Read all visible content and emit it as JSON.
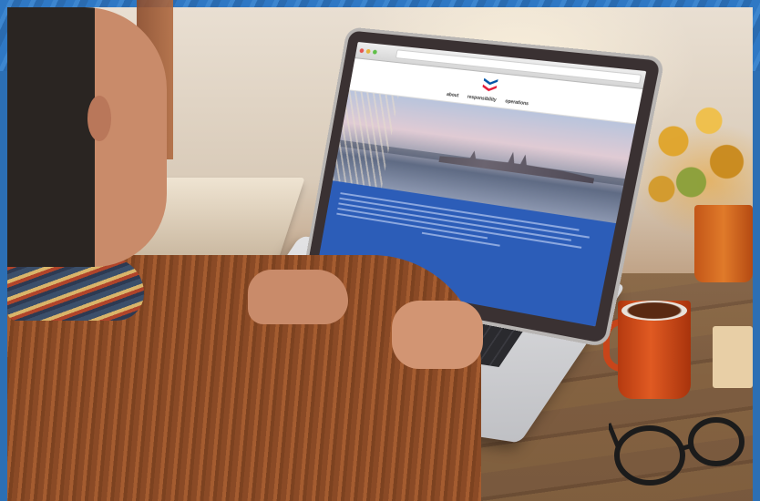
{
  "scene": {
    "description_alt": "",
    "accent_colors": {
      "blue_band": "#2c5db8",
      "sweater": "#a45c30",
      "mug": "#e05a22",
      "logo_blue": "#0054a6",
      "logo_red": "#e31937"
    }
  },
  "website": {
    "brand": "Chevron",
    "nav": [
      "about",
      "responsibility",
      "operations"
    ]
  }
}
